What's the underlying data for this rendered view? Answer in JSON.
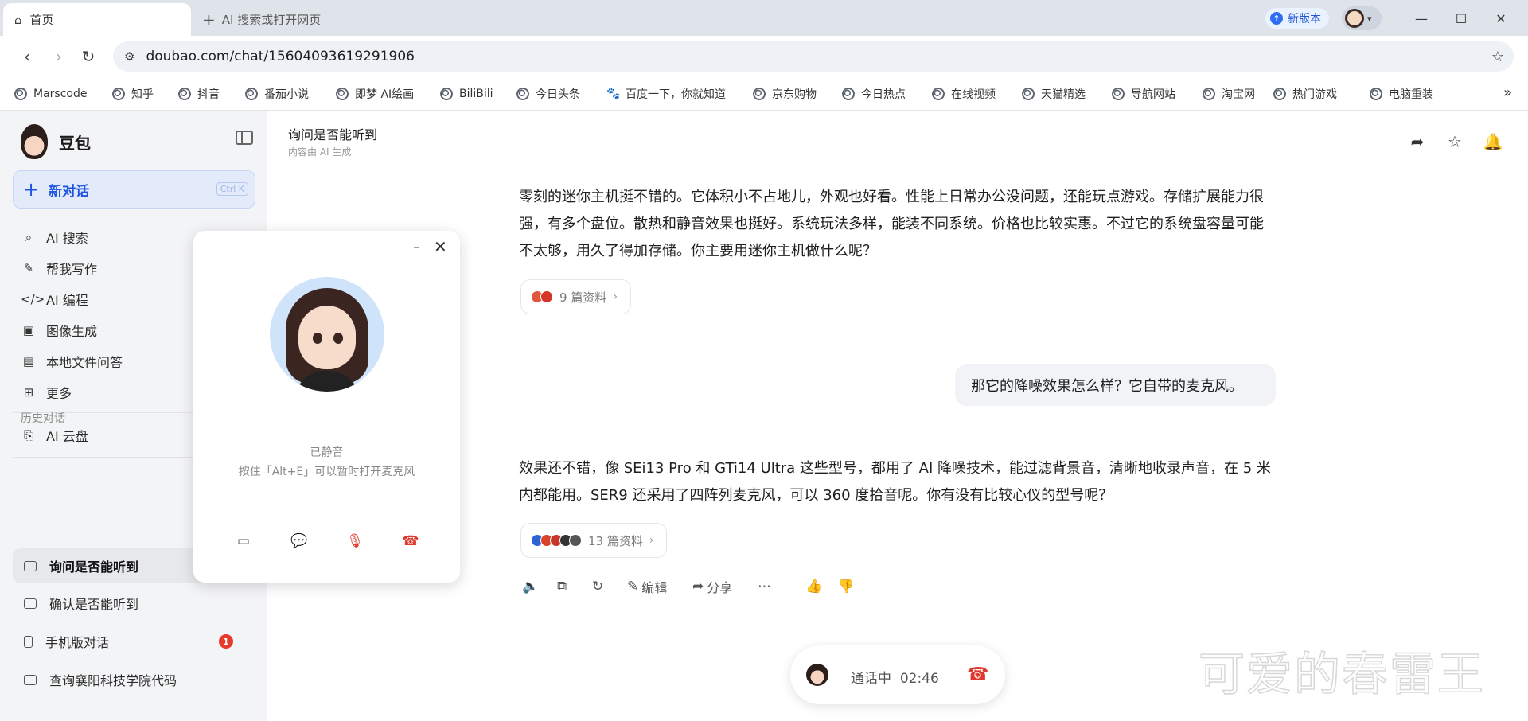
{
  "browser": {
    "active_tab": "首页",
    "new_tab": "AI 搜索或打开网页",
    "new_version": "新版本",
    "url": "doubao.com/chat/15604093619291906",
    "bookmarks": [
      "Marscode",
      "知乎",
      "抖音",
      "番茄小说",
      "即梦 AI绘画",
      "BiliBili",
      "今日头条",
      "百度一下，你就知道",
      "京东购物",
      "今日热点",
      "在线视频",
      "天猫精选",
      "导航网站",
      "淘宝网",
      "热门游戏",
      "电脑重装"
    ]
  },
  "sidebar": {
    "brand": "豆包",
    "new_chat": "新对话",
    "new_chat_shortcut": "Ctrl K",
    "nav": [
      "AI 搜索",
      "帮我写作",
      "AI 编程",
      "图像生成",
      "本地文件问答",
      "更多"
    ],
    "cloud": "AI 云盘",
    "history_title": "历史对话",
    "history": [
      "询问是否能听到",
      "确认是否能听到",
      "手机版对话",
      "查询襄阳科技学院代码"
    ],
    "history_badge": "1"
  },
  "call_panel": {
    "muted": "已静音",
    "hint": "按住「Alt+E」可以暂时打开麦克风"
  },
  "chat": {
    "title": "询问是否能听到",
    "subtitle": "内容由 AI 生成",
    "answer1": "零刻的迷你主机挺不错的。它体积小不占地儿，外观也好看。性能上日常办公没问题，还能玩点游戏。存储扩展能力很强，有多个盘位。散热和静音效果也挺好。系统玩法多样，能装不同系统。价格也比较实惠。不过它的系统盘容量可能不太够，用久了得加存储。你主要用迷你主机做什么呢？",
    "refs1": "9 篇资料",
    "user_msg": "那它的降噪效果怎么样？它自带的麦克风。",
    "answer2": "效果还不错，像 SEi13 Pro 和 GTi14 Ultra 这些型号，都用了 AI 降噪技术，能过滤背景音，清晰地收录声音，在 5 米内都能用。SER9 还采用了四阵列麦克风，可以 360 度拾音呢。你有没有比较心仪的型号呢？",
    "refs2": "13 篇资料",
    "edit": "编辑",
    "share": "分享"
  },
  "call_bar": {
    "status": "通话中",
    "time": "02:46"
  },
  "watermark": "可爱的春雷王",
  "colors": {
    "accent": "#1f55e2",
    "hangup": "#e03a2f",
    "badge": "#e8392d"
  }
}
